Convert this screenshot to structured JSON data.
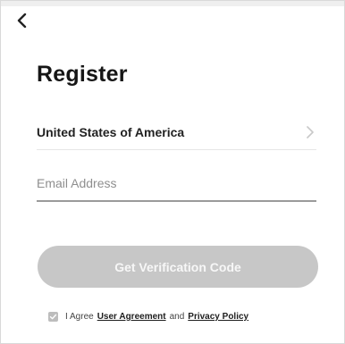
{
  "header": {
    "back_icon": "chevron-left-icon"
  },
  "page": {
    "title": "Register"
  },
  "country": {
    "label": "United States of America",
    "icon": "chevron-right-icon"
  },
  "email": {
    "placeholder": "Email Address",
    "value": ""
  },
  "action": {
    "verify_label": "Get Verification Code"
  },
  "agreement": {
    "prefix": "I Agree",
    "user_agreement": "User Agreement",
    "and_text": "and",
    "privacy_policy": "Privacy Policy",
    "checkbox_icon": "checkbox-icon"
  },
  "colors": {
    "button_disabled": "#c7c7c7",
    "text_primary": "#161616",
    "divider": "#e6e6e6"
  }
}
